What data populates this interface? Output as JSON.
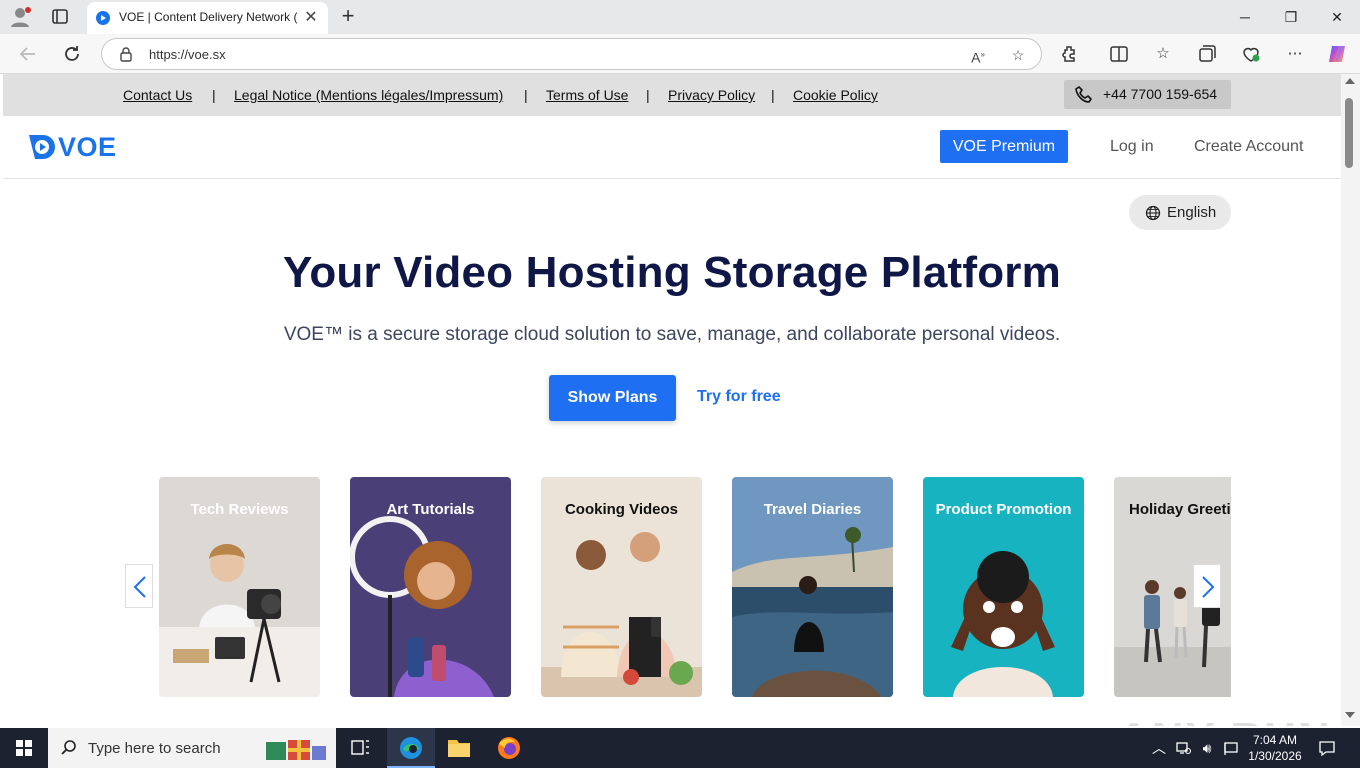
{
  "browser": {
    "tab_title": "VOE | Content Delivery Network (",
    "url": "https://voe.sx",
    "read_aloud_icon": "read-aloud-icon",
    "favorite_icon": "star-icon"
  },
  "legal_bar": {
    "links": [
      "Contact Us",
      "Legal Notice (Mentions légales/Impressum)",
      "Terms of Use",
      "Privacy Policy",
      "Cookie Policy"
    ],
    "separator": "|",
    "phone": "+44 7700 159-654"
  },
  "header": {
    "logo_text": "VOE",
    "premium_button": "VOE Premium",
    "login": "Log in",
    "create_account": "Create Account"
  },
  "language": {
    "label": "English"
  },
  "hero": {
    "title": "Your Video Hosting Storage Platform",
    "subtitle": "VOE™ is a secure storage cloud solution to save, manage, and collaborate personal videos.",
    "show_plans": "Show Plans",
    "try_free": "Try for free"
  },
  "carousel": {
    "cards": [
      {
        "label": "Tech Reviews",
        "label_color": "#ffffff",
        "bg": "#d9d6d2"
      },
      {
        "label": "Art Tutorials",
        "label_color": "#ffffff",
        "bg": "#5a4a8a"
      },
      {
        "label": "Cooking Videos",
        "label_color": "#111111",
        "bg": "#e8ddd0"
      },
      {
        "label": "Travel Diaries",
        "label_color": "#ffffff",
        "bg": "#6f8fb0"
      },
      {
        "label": "Product Promotion",
        "label_color": "#ffffff",
        "bg": "#17b3c0"
      },
      {
        "label": "Holiday Greeti",
        "label_color": "#111111",
        "bg": "#d8d8d6"
      }
    ]
  },
  "watermark": "ANY RUN",
  "taskbar": {
    "search_placeholder": "Type here to search",
    "time": "7:04 AM",
    "date": "1/30/2026"
  },
  "colors": {
    "accent": "#1e6ff2",
    "title": "#0f1747",
    "legal_bar": "#e0e0e0"
  }
}
